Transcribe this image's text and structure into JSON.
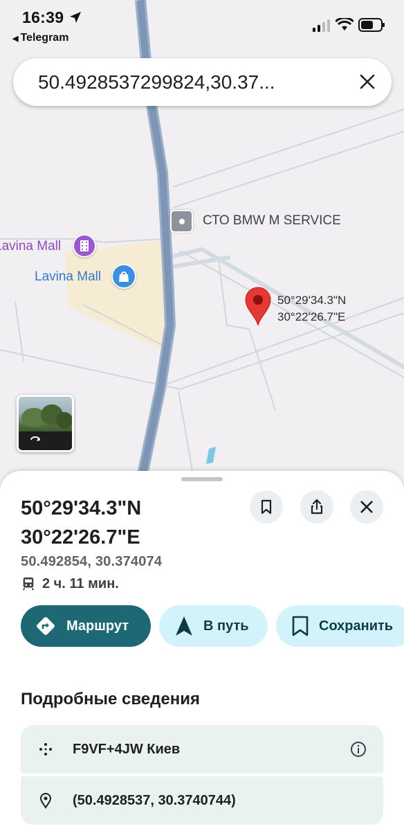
{
  "status_bar": {
    "time": "16:39",
    "back_app": "Telegram"
  },
  "search": {
    "query": "50.4928537299824,30.37..."
  },
  "map": {
    "poi_sto": "СТО BMW M SERVICE",
    "poi_mall_cinema": "Lavina Mall",
    "poi_mall_shop": "Lavina Mall",
    "pin_lat": "50°29'34.3\"N",
    "pin_lng": "30°22'26.7\"E"
  },
  "place": {
    "title_lat": "50°29'34.3\"N",
    "title_lng": "30°22'26.7\"E",
    "decimal": "50.492854, 30.374074",
    "transit_time": "2 ч. 11 мин."
  },
  "actions": {
    "route": "Маршрут",
    "go": "В путь",
    "save": "Сохранить"
  },
  "details": {
    "heading": "Подробные сведения",
    "plus_code": "F9VF+4JW Киев",
    "coordinates": "(50.4928537, 30.3740744)"
  },
  "colors": {
    "route_button": "#1e6774",
    "secondary_button": "#d3f3fb",
    "pin": "#e53935",
    "detail_bg": "#e9f2f1"
  },
  "icons": {
    "clear": "close-icon",
    "bookmark": "bookmark-icon",
    "share": "share-icon",
    "close": "close-icon",
    "transit": "train-icon",
    "route": "directions-icon",
    "go": "navigation-arrow-icon",
    "save": "bookmark-icon",
    "plus_code": "plus-code-icon",
    "location": "location-pin-icon",
    "info": "info-icon"
  }
}
